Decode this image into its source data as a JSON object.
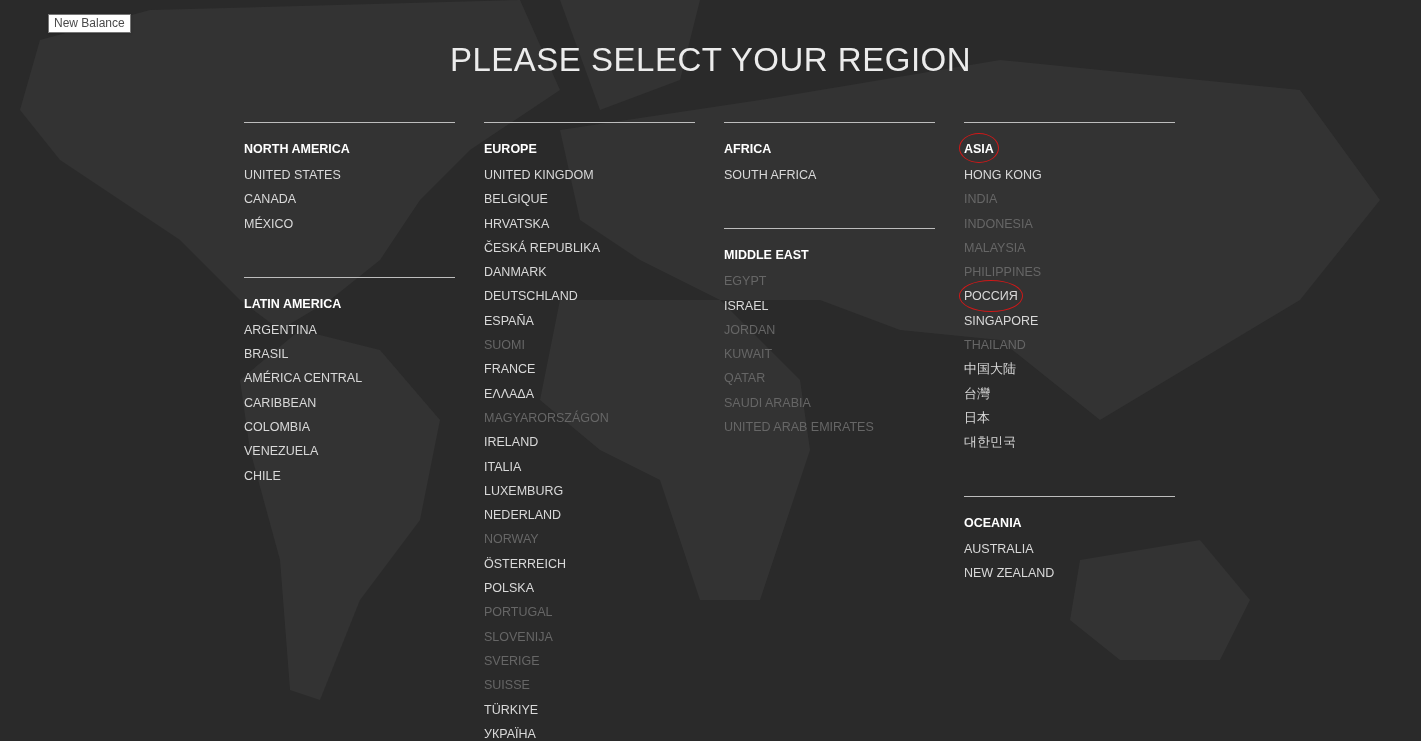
{
  "tooltip": {
    "text": "New Balance"
  },
  "title": "PLEASE SELECT YOUR REGION",
  "columns": [
    {
      "regions": [
        {
          "name": "NORTH AMERICA",
          "circled": false,
          "items": [
            {
              "label": "UNITED STATES",
              "disabled": false,
              "circled": false
            },
            {
              "label": "CANADA",
              "disabled": false,
              "circled": false
            },
            {
              "label": "MÉXICO",
              "disabled": false,
              "circled": false
            }
          ]
        },
        {
          "name": "LATIN AMERICA",
          "circled": false,
          "items": [
            {
              "label": "ARGENTINA",
              "disabled": false,
              "circled": false
            },
            {
              "label": "BRASIL",
              "disabled": false,
              "circled": false
            },
            {
              "label": "AMÉRICA CENTRAL",
              "disabled": false,
              "circled": false
            },
            {
              "label": "CARIBBEAN",
              "disabled": false,
              "circled": false
            },
            {
              "label": "COLOMBIA",
              "disabled": false,
              "circled": false
            },
            {
              "label": "VENEZUELA",
              "disabled": false,
              "circled": false
            },
            {
              "label": "CHILE",
              "disabled": false,
              "circled": false
            }
          ]
        }
      ]
    },
    {
      "regions": [
        {
          "name": "EUROPE",
          "circled": false,
          "items": [
            {
              "label": "UNITED KINGDOM",
              "disabled": false,
              "circled": false
            },
            {
              "label": "BELGIQUE",
              "disabled": false,
              "circled": false
            },
            {
              "label": "HRVATSKA",
              "disabled": false,
              "circled": false
            },
            {
              "label": "ČESKÁ REPUBLIKA",
              "disabled": false,
              "circled": false
            },
            {
              "label": "DANMARK",
              "disabled": false,
              "circled": false
            },
            {
              "label": "DEUTSCHLAND",
              "disabled": false,
              "circled": false
            },
            {
              "label": "ESPAÑA",
              "disabled": false,
              "circled": false
            },
            {
              "label": "SUOMI",
              "disabled": true,
              "circled": false
            },
            {
              "label": "FRANCE",
              "disabled": false,
              "circled": false
            },
            {
              "label": "ΕΛΛΑΔΑ",
              "disabled": false,
              "circled": false
            },
            {
              "label": "MAGYARORSZÁGON",
              "disabled": true,
              "circled": false
            },
            {
              "label": "IRELAND",
              "disabled": false,
              "circled": false
            },
            {
              "label": "ITALIA",
              "disabled": false,
              "circled": false
            },
            {
              "label": "LUXEMBURG",
              "disabled": false,
              "circled": false
            },
            {
              "label": "NEDERLAND",
              "disabled": false,
              "circled": false
            },
            {
              "label": "NORWAY",
              "disabled": true,
              "circled": false
            },
            {
              "label": "ÖSTERREICH",
              "disabled": false,
              "circled": false
            },
            {
              "label": "POLSKA",
              "disabled": false,
              "circled": false
            },
            {
              "label": "PORTUGAL",
              "disabled": true,
              "circled": false
            },
            {
              "label": "SLOVENIJA",
              "disabled": true,
              "circled": false
            },
            {
              "label": "SVERIGE",
              "disabled": true,
              "circled": false
            },
            {
              "label": "SUISSE",
              "disabled": true,
              "circled": false
            },
            {
              "label": "TÜRKIYE",
              "disabled": false,
              "circled": false
            },
            {
              "label": "УКРАЇНА",
              "disabled": false,
              "circled": false
            }
          ]
        }
      ]
    },
    {
      "regions": [
        {
          "name": "AFRICA",
          "circled": false,
          "items": [
            {
              "label": "SOUTH AFRICA",
              "disabled": false,
              "circled": false
            }
          ]
        },
        {
          "name": "MIDDLE EAST",
          "circled": false,
          "items": [
            {
              "label": "EGYPT",
              "disabled": true,
              "circled": false
            },
            {
              "label": "ISRAEL",
              "disabled": false,
              "circled": false
            },
            {
              "label": "JORDAN",
              "disabled": true,
              "circled": false
            },
            {
              "label": "KUWAIT",
              "disabled": true,
              "circled": false
            },
            {
              "label": "QATAR",
              "disabled": true,
              "circled": false
            },
            {
              "label": "SAUDI ARABIA",
              "disabled": true,
              "circled": false
            },
            {
              "label": "UNITED ARAB EMIRATES",
              "disabled": true,
              "circled": false
            }
          ]
        }
      ]
    },
    {
      "regions": [
        {
          "name": "ASIA",
          "circled": true,
          "items": [
            {
              "label": "HONG KONG",
              "disabled": false,
              "circled": false
            },
            {
              "label": "INDIA",
              "disabled": true,
              "circled": false
            },
            {
              "label": "INDONESIA",
              "disabled": true,
              "circled": false
            },
            {
              "label": "MALAYSIA",
              "disabled": true,
              "circled": false
            },
            {
              "label": "PHILIPPINES",
              "disabled": true,
              "circled": false
            },
            {
              "label": "РОССИЯ",
              "disabled": false,
              "circled": true
            },
            {
              "label": "SINGAPORE",
              "disabled": false,
              "circled": false
            },
            {
              "label": "THAILAND",
              "disabled": true,
              "circled": false
            },
            {
              "label": "中国大陆",
              "disabled": false,
              "circled": false
            },
            {
              "label": "台灣",
              "disabled": false,
              "circled": false
            },
            {
              "label": "日本",
              "disabled": false,
              "circled": false
            },
            {
              "label": "대한민국",
              "disabled": false,
              "circled": false
            }
          ]
        },
        {
          "name": "OCEANIA",
          "circled": false,
          "items": [
            {
              "label": "AUSTRALIA",
              "disabled": false,
              "circled": false
            },
            {
              "label": "NEW ZEALAND",
              "disabled": false,
              "circled": false
            }
          ]
        }
      ]
    }
  ]
}
